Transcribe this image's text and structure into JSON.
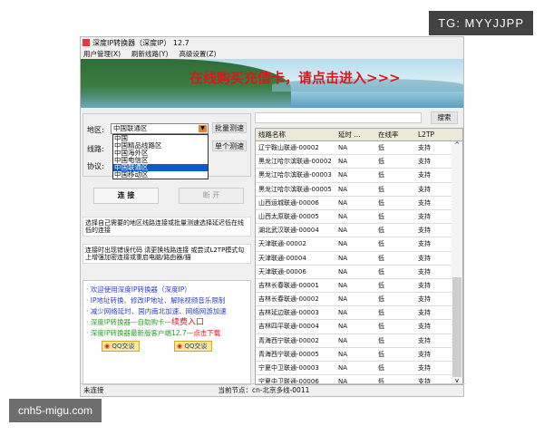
{
  "watermarks": {
    "top": "TG: MYYJJPP",
    "bottom": "cnh5-migu.com"
  },
  "window": {
    "title": "深度IP转换器（深度IP） 12.7"
  },
  "menu": [
    "用户管理(X)",
    "刷新线路(Y)",
    "高级设置(Z)"
  ],
  "banner": {
    "promo": "在线购买充值卡，请点击进入>>>"
  },
  "form": {
    "region_label": "地区:",
    "line_label": "线路:",
    "protocol_label": "协议:",
    "region_value": "中国联通区",
    "region_options": [
      "中国",
      "中国精品线路区",
      "中国海外区",
      "中国电信区",
      "中国联通区",
      "中国移动区"
    ],
    "selected_index": 4,
    "batch_test": "批量测速",
    "single_test": "单个测速"
  },
  "buttons": {
    "connect": "连 接",
    "disconnect": "断 开"
  },
  "notes": [
    "选择自己需要的地区线路连接或批量测速选择延迟低在线低的连接",
    "连接时出现错误代码 请更换线路连接 或尝试L2TP模式勾上增强加密连接或重启电脑/路由器/猫"
  ],
  "info": {
    "lines": [
      {
        "text": "· 欢迎使用深度IP转换器（深度IP）",
        "style": "b"
      },
      {
        "text": "· IP地址转换、修改IP地址、解除视频音乐限制",
        "style": "b"
      },
      {
        "text": "· 减少网络延时、国内南北加速、网络网游加速",
        "style": "b"
      },
      {
        "text": "· 深度IP转换器—自助购卡—",
        "extra": "续费入口",
        "style": "g"
      },
      {
        "text": "· 深度IP转换器最新版客户端12.7—",
        "extra": "点击下载",
        "style": "g"
      }
    ],
    "qq1": "QQ交谈",
    "qq2": "QQ交谈"
  },
  "search": {
    "value": "",
    "button": "搜索"
  },
  "table": {
    "headers": [
      "线路名称",
      "延时 ...",
      "在线率",
      "L2TP"
    ],
    "rows": [
      [
        "辽宁鞍山联通-00002",
        "NA",
        "低",
        "支持"
      ],
      [
        "黑龙江哈尔滨联通-00002",
        "NA",
        "低",
        "支持"
      ],
      [
        "黑龙江哈尔滨联通-00003",
        "NA",
        "低",
        "支持"
      ],
      [
        "黑龙江哈尔滨联通-00005",
        "NA",
        "低",
        "支持"
      ],
      [
        "山西运城联通-00006",
        "NA",
        "低",
        "支持"
      ],
      [
        "山西太原联通-00005",
        "NA",
        "低",
        "支持"
      ],
      [
        "湖北武汉联通-00004",
        "NA",
        "低",
        "支持"
      ],
      [
        "天津联通-00002",
        "NA",
        "低",
        "支持"
      ],
      [
        "天津联通-00004",
        "NA",
        "低",
        "支持"
      ],
      [
        "天津联通-00006",
        "NA",
        "低",
        "支持"
      ],
      [
        "吉林长春联通-00001",
        "NA",
        "低",
        "支持"
      ],
      [
        "吉林长春联通-00002",
        "NA",
        "低",
        "支持"
      ],
      [
        "吉林延边联通-00003",
        "NA",
        "低",
        "支持"
      ],
      [
        "吉林四平联通-00004",
        "NA",
        "低",
        "支持"
      ],
      [
        "青海西宁联通-00002",
        "NA",
        "低",
        "支持"
      ],
      [
        "青海西宁联通-00005",
        "NA",
        "低",
        "支持"
      ],
      [
        "宁夏中卫联通-00003",
        "NA",
        "低",
        "支持"
      ],
      [
        "宁夏中卫联通-00006",
        "NA",
        "低",
        "支持"
      ],
      [
        "甘肃兰州联通-00006",
        "NA",
        "低",
        "支持"
      ]
    ]
  },
  "status": {
    "state": "未连接",
    "node": "当前节点：cn-北京多线-0011"
  }
}
